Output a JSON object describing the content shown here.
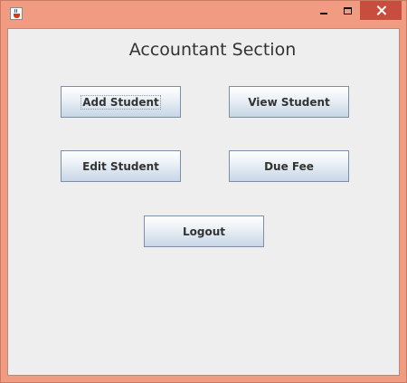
{
  "window": {
    "icon": "java-cup-icon",
    "controls": {
      "minimize": "minimize-icon",
      "maximize": "maximize-icon",
      "close": "close-icon",
      "close_color": "#c74e3f"
    },
    "frame_color": "#f09b82"
  },
  "main": {
    "heading": "Accountant Section",
    "buttons": {
      "add_student": "Add Student",
      "view_student": "View Student",
      "edit_student": "Edit Student",
      "due_fee": "Due Fee",
      "logout": "Logout"
    },
    "focused_button": "Add Student"
  }
}
